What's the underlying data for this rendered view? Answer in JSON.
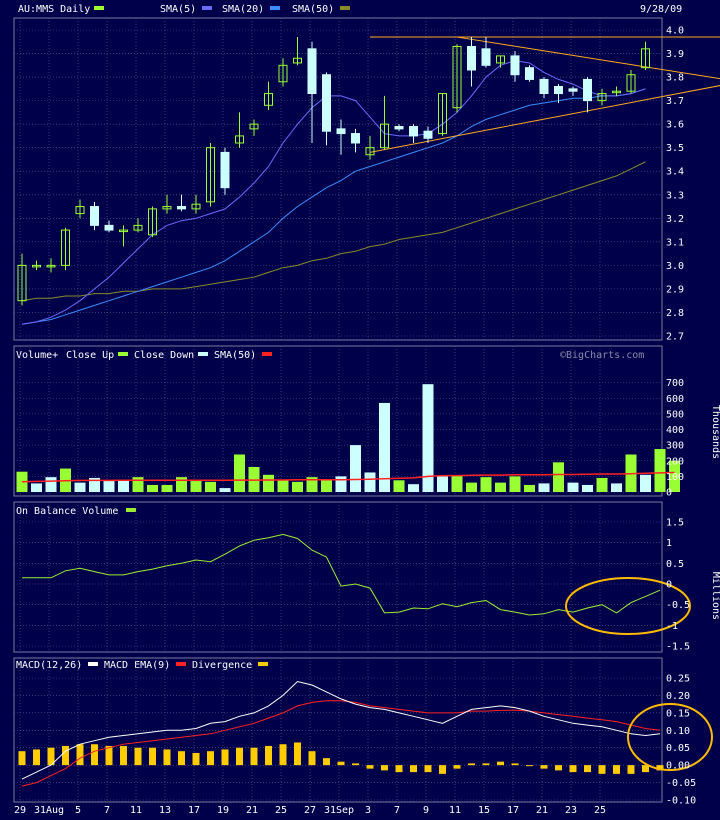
{
  "colors": {
    "background": "#00004a",
    "grid": "#5a5a8a",
    "up": "#99ff33",
    "down": "#ccffff",
    "sma5": "#6a6aff",
    "sma20": "#3a8cff",
    "sma50": "#8a8a2a",
    "volSma": "#ff2222",
    "obv": "#99ee33",
    "macd": "#ffffff",
    "signal": "#ff2222",
    "divergence": "#ffcc00",
    "annotation": "#ffbb00"
  },
  "header": {
    "symbol": "AU:MMS Daily",
    "sma5": "SMA(5)",
    "sma20": "SMA(20)",
    "sma50": "SMA(50)",
    "date": "9/28/09"
  },
  "volume_header": {
    "title": "Volume+",
    "close_up": "Close Up",
    "close_down": "Close Down",
    "sma": "SMA(50)",
    "credit": "©BigCharts.com",
    "unit": "Thousands"
  },
  "obv_header": {
    "title": "On Balance Volume",
    "unit": "Millions"
  },
  "macd_header": {
    "title": "MACD(12,26)",
    "ema": "MACD EMA(9)",
    "divergence": "Divergence"
  },
  "x_labels": [
    "29",
    "31Aug",
    "5",
    "7",
    "11",
    "13",
    "17",
    "19",
    "21",
    "25",
    "27",
    "31Sep",
    "3",
    "7",
    "9",
    "11",
    "15",
    "17",
    "21",
    "23",
    "25"
  ],
  "chart_data": [
    {
      "type": "candlestick",
      "title": "AU:MMS Daily",
      "ylim": [
        2.7,
        4.0
      ],
      "y_ticks": [
        4.0,
        3.9,
        3.8,
        3.7,
        3.6,
        3.5,
        3.4,
        3.3,
        3.2,
        3.1,
        3.0,
        2.9,
        2.8,
        2.7
      ],
      "y_tick_labels": [
        "4.0",
        "3.9",
        "3.8",
        "3.7",
        "3.6",
        "3.5",
        "3.4",
        "3.3",
        "3.2",
        "3.1",
        "3.0",
        "2.9",
        "2.8",
        "2.7"
      ],
      "candles": [
        {
          "o": 2.85,
          "h": 3.05,
          "l": 2.83,
          "c": 3.0
        },
        {
          "o": 3.0,
          "h": 3.02,
          "l": 2.98,
          "c": 3.0
        },
        {
          "o": 3.0,
          "h": 3.03,
          "l": 2.97,
          "c": 3.0
        },
        {
          "o": 3.0,
          "h": 3.16,
          "l": 2.98,
          "c": 3.15
        },
        {
          "o": 3.22,
          "h": 3.28,
          "l": 3.2,
          "c": 3.25
        },
        {
          "o": 3.25,
          "h": 3.27,
          "l": 3.15,
          "c": 3.17
        },
        {
          "o": 3.17,
          "h": 3.19,
          "l": 3.14,
          "c": 3.15
        },
        {
          "o": 3.15,
          "h": 3.17,
          "l": 3.08,
          "c": 3.15
        },
        {
          "o": 3.15,
          "h": 3.2,
          "l": 3.14,
          "c": 3.17
        },
        {
          "o": 3.13,
          "h": 3.25,
          "l": 3.12,
          "c": 3.24
        },
        {
          "o": 3.24,
          "h": 3.3,
          "l": 3.22,
          "c": 3.25
        },
        {
          "o": 3.25,
          "h": 3.3,
          "l": 3.23,
          "c": 3.24
        },
        {
          "o": 3.24,
          "h": 3.3,
          "l": 3.22,
          "c": 3.26
        },
        {
          "o": 3.27,
          "h": 3.52,
          "l": 3.25,
          "c": 3.5
        },
        {
          "o": 3.48,
          "h": 3.5,
          "l": 3.3,
          "c": 3.33
        },
        {
          "o": 3.52,
          "h": 3.65,
          "l": 3.5,
          "c": 3.55
        },
        {
          "o": 3.58,
          "h": 3.62,
          "l": 3.55,
          "c": 3.6
        },
        {
          "o": 3.68,
          "h": 3.78,
          "l": 3.66,
          "c": 3.73
        },
        {
          "o": 3.78,
          "h": 3.88,
          "l": 3.76,
          "c": 3.85
        },
        {
          "o": 3.86,
          "h": 3.97,
          "l": 3.85,
          "c": 3.88
        },
        {
          "o": 3.92,
          "h": 3.95,
          "l": 3.52,
          "c": 3.73
        },
        {
          "o": 3.81,
          "h": 3.82,
          "l": 3.51,
          "c": 3.57
        },
        {
          "o": 3.58,
          "h": 3.62,
          "l": 3.47,
          "c": 3.56
        },
        {
          "o": 3.56,
          "h": 3.58,
          "l": 3.48,
          "c": 3.52
        },
        {
          "o": 3.47,
          "h": 3.55,
          "l": 3.45,
          "c": 3.5
        },
        {
          "o": 3.5,
          "h": 3.72,
          "l": 3.49,
          "c": 3.6
        },
        {
          "o": 3.59,
          "h": 3.6,
          "l": 3.57,
          "c": 3.58
        },
        {
          "o": 3.59,
          "h": 3.6,
          "l": 3.52,
          "c": 3.55
        },
        {
          "o": 3.57,
          "h": 3.59,
          "l": 3.52,
          "c": 3.54
        },
        {
          "o": 3.56,
          "h": 3.73,
          "l": 3.55,
          "c": 3.73
        },
        {
          "o": 3.67,
          "h": 3.94,
          "l": 3.65,
          "c": 3.93
        },
        {
          "o": 3.93,
          "h": 3.97,
          "l": 3.76,
          "c": 3.83
        },
        {
          "o": 3.92,
          "h": 3.97,
          "l": 3.84,
          "c": 3.85
        },
        {
          "o": 3.86,
          "h": 3.89,
          "l": 3.84,
          "c": 3.89
        },
        {
          "o": 3.89,
          "h": 3.91,
          "l": 3.78,
          "c": 3.81
        },
        {
          "o": 3.84,
          "h": 3.85,
          "l": 3.78,
          "c": 3.79
        },
        {
          "o": 3.79,
          "h": 3.8,
          "l": 3.71,
          "c": 3.73
        },
        {
          "o": 3.76,
          "h": 3.77,
          "l": 3.69,
          "c": 3.73
        },
        {
          "o": 3.75,
          "h": 3.76,
          "l": 3.72,
          "c": 3.74
        },
        {
          "o": 3.79,
          "h": 3.8,
          "l": 3.65,
          "c": 3.7
        },
        {
          "o": 3.7,
          "h": 3.75,
          "l": 3.68,
          "c": 3.73
        },
        {
          "o": 3.74,
          "h": 3.76,
          "l": 3.72,
          "c": 3.74
        },
        {
          "o": 3.74,
          "h": 3.83,
          "l": 3.73,
          "c": 3.81
        },
        {
          "o": 3.84,
          "h": 3.95,
          "l": 3.83,
          "c": 3.92
        }
      ],
      "sma5": [
        2.75,
        2.76,
        2.78,
        2.81,
        2.85,
        2.9,
        2.95,
        3.01,
        3.07,
        3.13,
        3.17,
        3.19,
        3.2,
        3.22,
        3.24,
        3.29,
        3.35,
        3.42,
        3.52,
        3.6,
        3.67,
        3.72,
        3.72,
        3.7,
        3.63,
        3.56,
        3.55,
        3.55,
        3.56,
        3.6,
        3.65,
        3.72,
        3.8,
        3.85,
        3.87,
        3.86,
        3.82,
        3.79,
        3.77,
        3.74,
        3.72,
        3.72,
        3.73,
        3.75
      ],
      "sma20": [
        2.75,
        2.76,
        2.77,
        2.79,
        2.81,
        2.83,
        2.85,
        2.87,
        2.89,
        2.91,
        2.93,
        2.95,
        2.97,
        2.99,
        3.02,
        3.06,
        3.1,
        3.14,
        3.2,
        3.25,
        3.29,
        3.33,
        3.36,
        3.4,
        3.42,
        3.44,
        3.46,
        3.48,
        3.5,
        3.52,
        3.55,
        3.59,
        3.62,
        3.64,
        3.66,
        3.68,
        3.69,
        3.7,
        3.71,
        3.71,
        3.72,
        3.72,
        3.73,
        3.75
      ],
      "sma50": [
        2.85,
        2.86,
        2.86,
        2.87,
        2.87,
        2.88,
        2.88,
        2.89,
        2.89,
        2.9,
        2.9,
        2.9,
        2.91,
        2.92,
        2.93,
        2.94,
        2.95,
        2.97,
        2.99,
        3.0,
        3.02,
        3.03,
        3.05,
        3.06,
        3.08,
        3.09,
        3.11,
        3.12,
        3.13,
        3.14,
        3.16,
        3.18,
        3.2,
        3.22,
        3.24,
        3.26,
        3.28,
        3.3,
        3.32,
        3.34,
        3.36,
        3.38,
        3.41,
        3.44
      ],
      "trendlines": [
        {
          "name": "resistance",
          "points": [
            {
              "i": 24,
              "y": 3.97
            },
            {
              "i": 49.5,
              "y": 3.97
            }
          ]
        },
        {
          "name": "descending",
          "points": [
            {
              "i": 30,
              "y": 3.97
            },
            {
              "i": 49.5,
              "y": 3.78
            }
          ]
        },
        {
          "name": "support",
          "points": [
            {
              "i": 24,
              "y": 3.48
            },
            {
              "i": 49.5,
              "y": 3.78
            }
          ]
        }
      ]
    },
    {
      "type": "bar",
      "title": "Volume",
      "ylim": [
        0,
        800
      ],
      "y_ticks": [
        0,
        100,
        200,
        300,
        400,
        500,
        600,
        700
      ],
      "y_tick_labels": [
        "0",
        "100",
        "200",
        "300",
        "400",
        "500",
        "600",
        "700"
      ],
      "values": [
        130,
        55,
        95,
        150,
        60,
        90,
        70,
        75,
        95,
        45,
        45,
        95,
        70,
        65,
        25,
        240,
        160,
        110,
        80,
        65,
        95,
        80,
        100,
        300,
        125,
        570,
        75,
        50,
        690,
        100,
        105,
        60,
        95,
        60,
        100,
        45,
        55,
        190,
        60,
        45,
        90,
        55,
        240,
        110,
        275,
        200
      ],
      "up": [
        1,
        0,
        0,
        1,
        0,
        0,
        0,
        0,
        1,
        1,
        1,
        1,
        1,
        1,
        0,
        1,
        1,
        1,
        1,
        1,
        1,
        1,
        0,
        0,
        0,
        0,
        1,
        0,
        0,
        0,
        1,
        1,
        1,
        1,
        1,
        1,
        0,
        1,
        0,
        0,
        1,
        0,
        1,
        0,
        1,
        1
      ],
      "sma50": [
        65,
        68,
        70,
        72,
        74,
        74,
        74,
        75,
        75,
        75,
        75,
        75,
        75,
        75,
        75,
        76,
        76,
        77,
        77,
        78,
        78,
        78,
        79,
        80,
        82,
        85,
        88,
        90,
        100,
        105,
        105,
        107,
        108,
        108,
        110,
        110,
        110,
        112,
        112,
        113,
        115,
        115,
        117,
        120,
        122,
        125
      ]
    },
    {
      "type": "line",
      "title": "On Balance Volume",
      "ylim": [
        -1.5,
        1.5
      ],
      "y_ticks": [
        1.5,
        1,
        0.5,
        0,
        -0.5,
        -1,
        -1.5
      ],
      "y_tick_labels": [
        "1.5",
        "1",
        "0.5",
        "0",
        "-0.5",
        "-1",
        "-1.5"
      ],
      "values": [
        0.15,
        0.15,
        0.15,
        0.32,
        0.38,
        0.3,
        0.22,
        0.22,
        0.3,
        0.36,
        0.44,
        0.5,
        0.58,
        0.54,
        0.72,
        0.92,
        1.06,
        1.12,
        1.2,
        1.1,
        0.82,
        0.65,
        -0.05,
        0.0,
        -0.1,
        -0.7,
        -0.68,
        -0.58,
        -0.6,
        -0.48,
        -0.55,
        -0.45,
        -0.4,
        -0.62,
        -0.68,
        -0.75,
        -0.72,
        -0.62,
        -0.68,
        -0.58,
        -0.5,
        -0.7,
        -0.45,
        -0.3,
        -0.15
      ],
      "annotation": "ellipse"
    },
    {
      "type": "line",
      "title": "MACD(12,26)",
      "ylim": [
        -0.1,
        0.25
      ],
      "y_ticks": [
        0.25,
        0.2,
        0.15,
        0.1,
        0.05,
        0.0,
        -0.05,
        -0.1
      ],
      "y_tick_labels": [
        "0.25",
        "0.20",
        "0.15",
        "0.10",
        "0.05",
        "0.00",
        "-0.05",
        "-0.10"
      ],
      "macd": [
        -0.04,
        -0.02,
        0.0,
        0.04,
        0.06,
        0.07,
        0.08,
        0.085,
        0.09,
        0.095,
        0.1,
        0.1,
        0.105,
        0.12,
        0.125,
        0.14,
        0.15,
        0.17,
        0.2,
        0.24,
        0.23,
        0.21,
        0.19,
        0.175,
        0.165,
        0.16,
        0.15,
        0.14,
        0.13,
        0.12,
        0.14,
        0.16,
        0.165,
        0.17,
        0.165,
        0.155,
        0.14,
        0.13,
        0.12,
        0.115,
        0.11,
        0.1,
        0.09,
        0.085,
        0.09
      ],
      "signal": [
        -0.06,
        -0.05,
        -0.03,
        -0.01,
        0.02,
        0.04,
        0.05,
        0.06,
        0.065,
        0.07,
        0.075,
        0.08,
        0.085,
        0.09,
        0.1,
        0.11,
        0.12,
        0.135,
        0.15,
        0.17,
        0.18,
        0.185,
        0.185,
        0.18,
        0.17,
        0.165,
        0.16,
        0.155,
        0.15,
        0.15,
        0.15,
        0.155,
        0.155,
        0.157,
        0.158,
        0.155,
        0.15,
        0.145,
        0.14,
        0.135,
        0.13,
        0.125,
        0.115,
        0.105,
        0.1
      ],
      "divergence": [
        0.04,
        0.045,
        0.05,
        0.055,
        0.06,
        0.06,
        0.055,
        0.055,
        0.05,
        0.05,
        0.045,
        0.04,
        0.035,
        0.04,
        0.045,
        0.05,
        0.05,
        0.055,
        0.06,
        0.065,
        0.04,
        0.02,
        0.01,
        0.005,
        -0.01,
        -0.015,
        -0.02,
        -0.02,
        -0.02,
        -0.025,
        -0.01,
        0.005,
        0.005,
        0.01,
        0.005,
        0.0,
        -0.01,
        -0.015,
        -0.02,
        -0.02,
        -0.025,
        -0.025,
        -0.025,
        -0.02,
        -0.015
      ],
      "annotation": "ellipse"
    }
  ]
}
